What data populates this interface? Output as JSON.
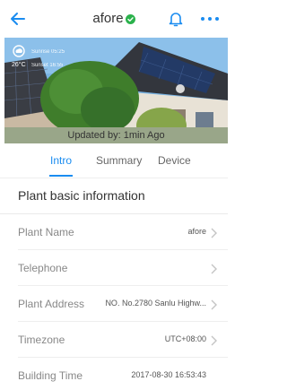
{
  "header": {
    "title": "afore",
    "icons": {
      "back": "back-arrow-icon",
      "verified": "verified-check-icon",
      "bell": "bell-icon",
      "more": "more-dots-icon"
    },
    "accent_color": "#1a8cf0",
    "verified_color": "#2bb24c"
  },
  "hero": {
    "weather_icon": "weather-cloud-icon",
    "temperature": "26°C",
    "sunrise": "Sunrise 05:25",
    "sunset": "Sunset 16:55",
    "updated": "Updated by: 1min Ago"
  },
  "tabs": [
    {
      "label": "Intro",
      "active": true
    },
    {
      "label": "Summary",
      "active": false
    },
    {
      "label": "Device",
      "active": false
    }
  ],
  "section": {
    "title": "Plant basic information"
  },
  "rows": [
    {
      "label": "Plant Name",
      "value": "afore",
      "chevron": true
    },
    {
      "label": "Telephone",
      "value": "",
      "chevron": true
    },
    {
      "label": "Plant Address",
      "value": "NO. No.2780 Sanlu Highw...",
      "chevron": true
    },
    {
      "label": "Timezone",
      "value": "UTC+08:00",
      "chevron": true
    },
    {
      "label": "Building Time",
      "value": "2017-08-30 16:53:43",
      "chevron": false
    }
  ]
}
